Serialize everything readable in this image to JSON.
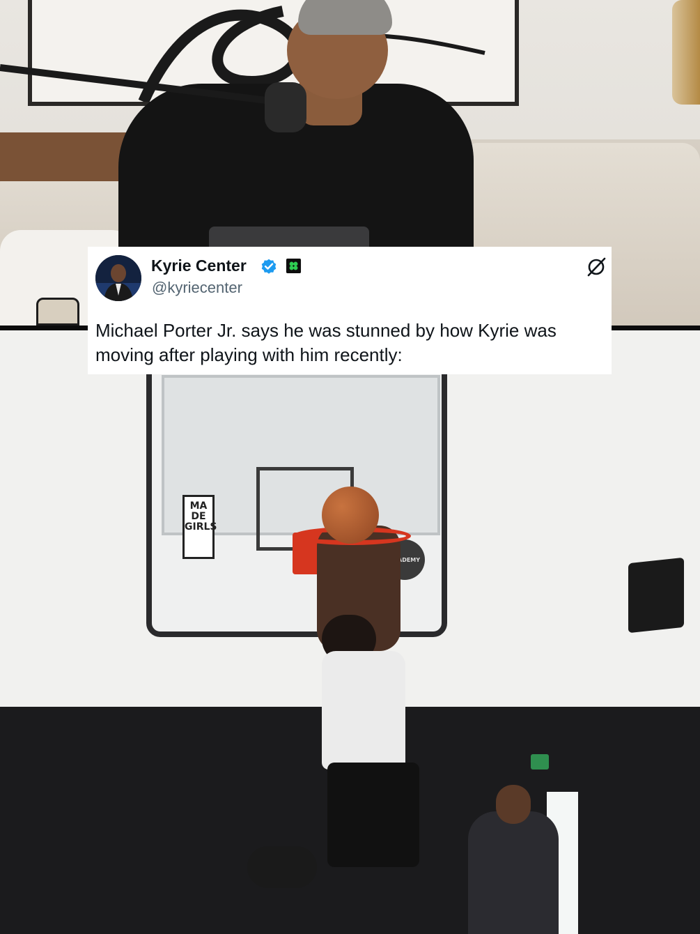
{
  "tweet": {
    "display_name": "Kyrie Center",
    "handle": "@kyriecenter",
    "text": "Michael Porter Jr. says he was stunned by how Kyrie was moving after playing with him recently:",
    "verified": true,
    "badge_icon": "green-flag-icon",
    "action_icon": "grok-icon"
  },
  "scene": {
    "backboard_logo_left": "MA DE GIRLS",
    "backboard_logo_right": "ACADEMY"
  },
  "colors": {
    "verified_blue": "#1d9bf0",
    "text_primary": "#0f1419",
    "text_secondary": "#536471",
    "rim_red": "#d6361f"
  }
}
